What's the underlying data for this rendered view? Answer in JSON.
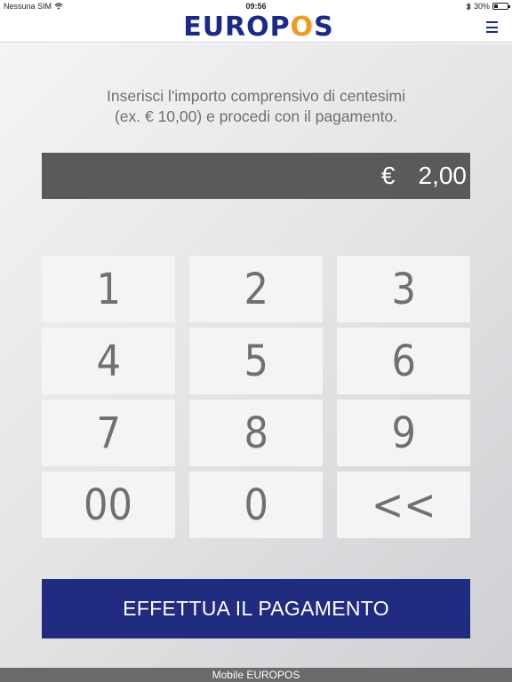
{
  "status_bar": {
    "carrier": "Nessuna SIM",
    "time": "09:56",
    "battery_percent": "30%",
    "battery_level": 0.3,
    "icons": [
      "wifi-icon",
      "bluetooth-icon",
      "battery-icon"
    ]
  },
  "header": {
    "logo_text_before": "EUROP",
    "logo_accent": "O",
    "logo_text_after": "S",
    "menu_icon": "hamburger-menu-icon"
  },
  "main": {
    "instruction_line1": "Inserisci l'importo comprensivo di centesimi",
    "instruction_line2": "(ex. € 10,00) e procedi con il pagamento.",
    "currency_symbol": "€",
    "amount": "2,00",
    "keys": [
      "1",
      "2",
      "3",
      "4",
      "5",
      "6",
      "7",
      "8",
      "9",
      "00",
      "0",
      "<<"
    ],
    "pay_button_label": "EFFETTUA IL PAGAMENTO"
  },
  "footer": {
    "text": "Mobile EUROPOS"
  },
  "colors": {
    "brand_blue": "#1f2c7f",
    "brand_orange": "#f39a1d",
    "display_bg": "#5a5a5a",
    "key_bg": "#f4f4f4"
  }
}
